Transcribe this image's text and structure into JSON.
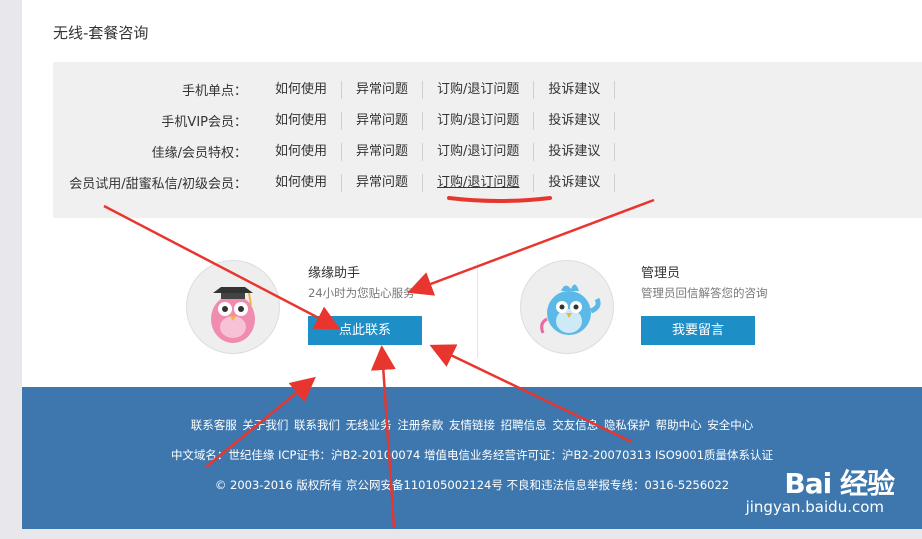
{
  "section": {
    "title": "无线-套餐咨询"
  },
  "faq": {
    "rows": [
      {
        "label": "手机单点：",
        "links": [
          "如何使用",
          "异常问题",
          "订购/退订问题",
          "投诉建议"
        ]
      },
      {
        "label": "手机VIP会员：",
        "links": [
          "如何使用",
          "异常问题",
          "订购/退订问题",
          "投诉建议"
        ]
      },
      {
        "label": "佳缘/会员特权：",
        "links": [
          "如何使用",
          "异常问题",
          "订购/退订问题",
          "投诉建议"
        ]
      },
      {
        "label": "会员试用/甜蜜私信/初级会员：",
        "links": [
          "如何使用",
          "异常问题",
          "订购/退订问题",
          "投诉建议"
        ]
      }
    ]
  },
  "services": {
    "assistant": {
      "name": "缘缘助手",
      "desc": "24小时为您贴心服务",
      "button": "点此联系"
    },
    "admin": {
      "name": "管理员",
      "desc": "管理员回信解答您的咨询",
      "button": "我要留言"
    }
  },
  "footer": {
    "links": [
      "联系客服",
      "关于我们",
      "联系我们",
      "无线业务",
      "注册条款",
      "友情链接",
      "招聘信息",
      "交友信息",
      "隐私保护",
      "帮助中心",
      "安全中心"
    ],
    "license": "中文域名：世纪佳缘 ICP证书：沪B2-20100074 增值电信业务经营许可证：沪B2-20070313 ISO9001质量体系认证",
    "copyright": "© 2003-2016 版权所有    京公网安备110105002124号    不良和违法信息举报专线：0316-5256022"
  },
  "watermark": {
    "logo": "Bai 经验",
    "url": "jingyan.baidu.com"
  },
  "colors": {
    "button": "#1e8fc6",
    "footer": "#3e77ad",
    "annotation": "#e8362f"
  }
}
